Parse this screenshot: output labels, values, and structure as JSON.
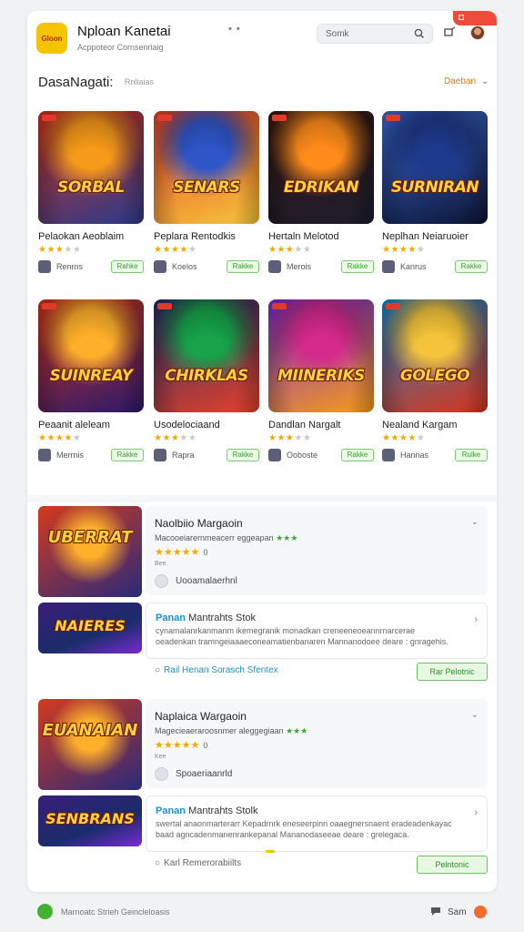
{
  "header": {
    "logo_text": "Gloon",
    "app_title": "Nploan Kanetai",
    "app_subtitle": "Acppoteor Cornsenriaig",
    "menu_dots": "• •",
    "search_placeholder": "Somk",
    "accent_color": "#f5c400"
  },
  "section": {
    "title": "DasaNagati:",
    "subtitle": "Rnliaias",
    "dropdown_label": "Daeban"
  },
  "tiles": [
    {
      "title": "Pelaokan Aeoblaim",
      "stars": 3,
      "developer": "Renrns",
      "button": "Rahke",
      "art_word": "SORBAL",
      "colors": [
        "#f59a1a",
        "#d6321e",
        "#2a3a8a"
      ]
    },
    {
      "title": "Peplara Rentodkis",
      "stars": 4,
      "developer": "Koelos",
      "button": "Rakke",
      "art_word": "SENARS",
      "colors": [
        "#2f56c8",
        "#e6402a",
        "#f5c43a"
      ]
    },
    {
      "title": "Hertaln Melotod",
      "stars": 3,
      "developer": "Merois",
      "button": "Rakke",
      "art_word": "EDRIKAN",
      "colors": [
        "#ff8b1a",
        "#3a1a10",
        "#1b1b2e"
      ]
    },
    {
      "title": "Neplhan Neiaruoier",
      "stars": 4,
      "developer": "Kanrus",
      "button": "Rakke",
      "art_word": "SURNIRAN",
      "colors": [
        "#1e3a8c",
        "#3e6ed8",
        "#0c1333"
      ]
    },
    {
      "title": "Peaanit aleleam",
      "stars": 4,
      "developer": "Merrnis",
      "button": "Rakke",
      "art_word": "SUINREAY",
      "colors": [
        "#ffb02a",
        "#d7331b",
        "#2a1a6a"
      ]
    },
    {
      "title": "Usodelociaand",
      "stars": 3,
      "developer": "Rapra",
      "button": "Rakke",
      "art_word": "CHIRKLAS",
      "colors": [
        "#16a34a",
        "#1b2f6a",
        "#e6402a"
      ]
    },
    {
      "title": "Dandlan Nargalt",
      "stars": 3,
      "developer": "Ooboste",
      "button": "Rakke",
      "art_word": "MIINERIKS",
      "colors": [
        "#d42a8b",
        "#7a2ad4",
        "#f59a1a"
      ]
    },
    {
      "title": "Nealand Kargam",
      "stars": 4,
      "developer": "Hannas",
      "button": "Rulke",
      "art_word": "GOLEGO",
      "colors": [
        "#f5c43a",
        "#1e88c8",
        "#d7331b"
      ]
    }
  ],
  "featured": [
    {
      "img_top_word": "UBERRAT",
      "img_bottom_word": "NAIERES",
      "title": "Naolbiio Margaoin",
      "line": "Macooeiarernmeacerr eggeapan",
      "stars": 5,
      "star_num": "0",
      "mini": "Bee",
      "user": "Uooamalaerhnl",
      "sub_title_blue": "Panan",
      "sub_title_rest": "Mantrahts Stok",
      "sub_desc": "cynamalanrkanmanm ikemegranik monadkan creneeneoeannrnarcerae oeadenkan tramngeiaaaeconeamatienbanaren Mannanodoee deare : gnragehis.",
      "link": "Rail Henan Sorasch Sfentex",
      "button": "Rar Pelotnic"
    },
    {
      "img_top_word": "EUANAIAN",
      "img_bottom_word": "SENBRANS",
      "title": "Naplaica Wargaoin",
      "line": "Magecieaeraroosnmer aleggegiaan",
      "stars": 5,
      "star_num": "0",
      "mini": "Kee",
      "user": "Spoaeriaanrld",
      "sub_title_blue": "Panan",
      "sub_title_rest": "Mantrahts Stolk",
      "sub_desc": "swertal anaonmarterarr Kepadrnrk eneseerpinn oaaegnersnaent eradeadenkayac baad agncadenmanenrankepanal Mananodaseeae deare : grelegaca.",
      "link": "Karl Remerorabiilts",
      "button": "Pelntonic"
    }
  ],
  "footer": {
    "text": "Marnoatc Strieh Geincleloasis",
    "chat_label": "Sam"
  }
}
